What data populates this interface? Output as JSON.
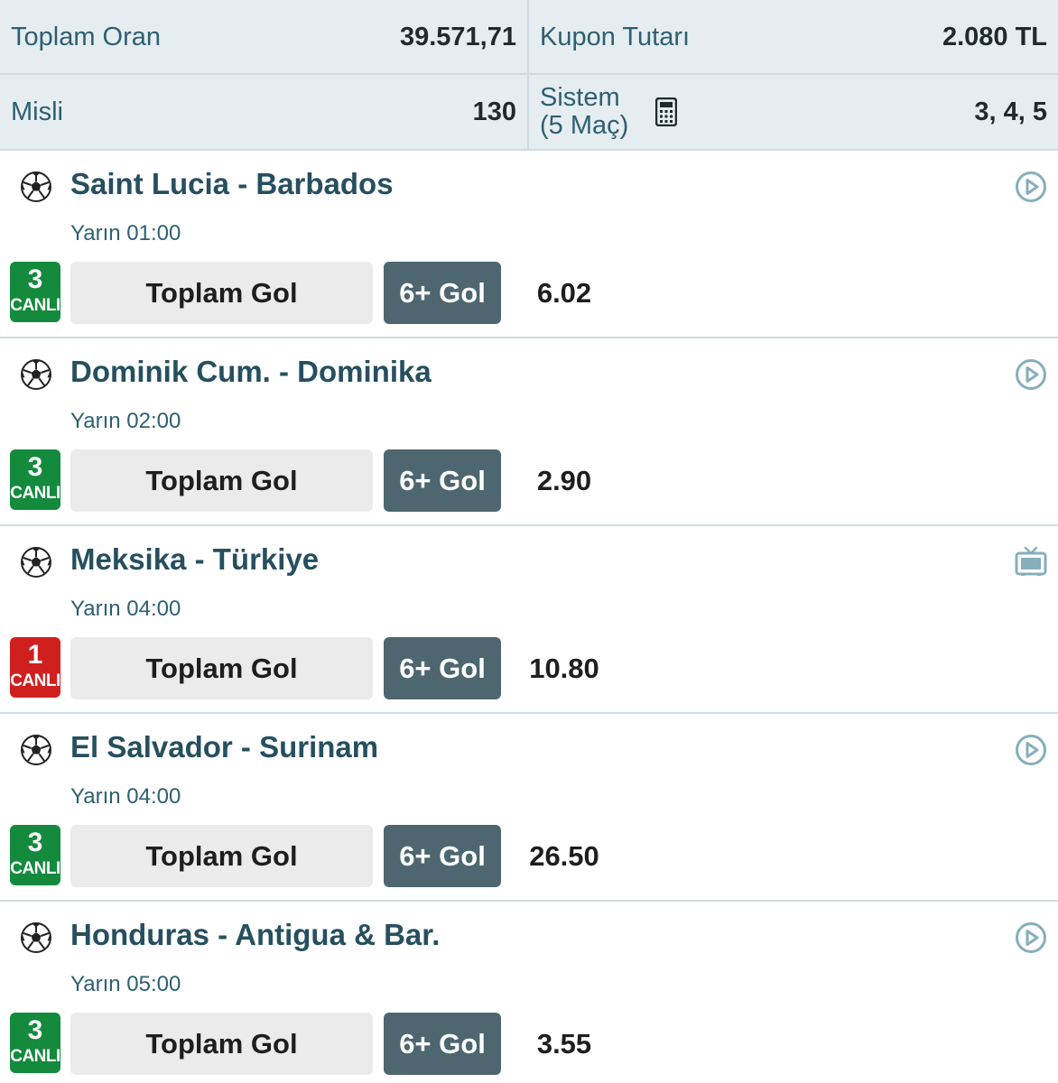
{
  "summary": {
    "toplam_oran_label": "Toplam Oran",
    "toplam_oran_value": "39.571,71",
    "kupon_tutari_label": "Kupon Tutarı",
    "kupon_tutari_value": "2.080 TL",
    "misli_label": "Misli",
    "misli_value": "130",
    "sistem_label_line1": "Sistem",
    "sistem_label_line2": "(5 Maç)",
    "sistem_value": "3, 4, 5"
  },
  "icons": {
    "sport": "soccer-ball-icon",
    "calculator": "calculator-icon",
    "stream": "play-circle-icon",
    "tv": "tv-icon"
  },
  "colors": {
    "header_bg": "#e6edf1",
    "team_text": "#264f5f",
    "badge_green": "#148a3c",
    "badge_red": "#d01f1f",
    "pick_bg": "#4d6670",
    "market_bg": "#ebebeb"
  },
  "matches": [
    {
      "teams": "Saint Lucia - Barbados",
      "time": "Yarın 01:00",
      "badge_num": "3",
      "badge_label": "CANLI",
      "badge_color": "green",
      "market": "Toplam Gol",
      "pick": "6+ Gol",
      "odd": "6.02",
      "media_icon": "play"
    },
    {
      "teams": "Dominik Cum. - Dominika",
      "time": "Yarın 02:00",
      "badge_num": "3",
      "badge_label": "CANLI",
      "badge_color": "green",
      "market": "Toplam Gol",
      "pick": "6+ Gol",
      "odd": "2.90",
      "media_icon": "play"
    },
    {
      "teams": "Meksika - Türkiye",
      "time": "Yarın 04:00",
      "badge_num": "1",
      "badge_label": "CANLI",
      "badge_color": "red",
      "market": "Toplam Gol",
      "pick": "6+ Gol",
      "odd": "10.80",
      "media_icon": "tv"
    },
    {
      "teams": "El Salvador - Surinam",
      "time": "Yarın 04:00",
      "badge_num": "3",
      "badge_label": "CANLI",
      "badge_color": "green",
      "market": "Toplam Gol",
      "pick": "6+ Gol",
      "odd": "26.50",
      "media_icon": "play"
    },
    {
      "teams": "Honduras - Antigua & Bar.",
      "time": "Yarın 05:00",
      "badge_num": "3",
      "badge_label": "CANLI",
      "badge_color": "green",
      "market": "Toplam Gol",
      "pick": "6+ Gol",
      "odd": "3.55",
      "media_icon": "play"
    }
  ]
}
